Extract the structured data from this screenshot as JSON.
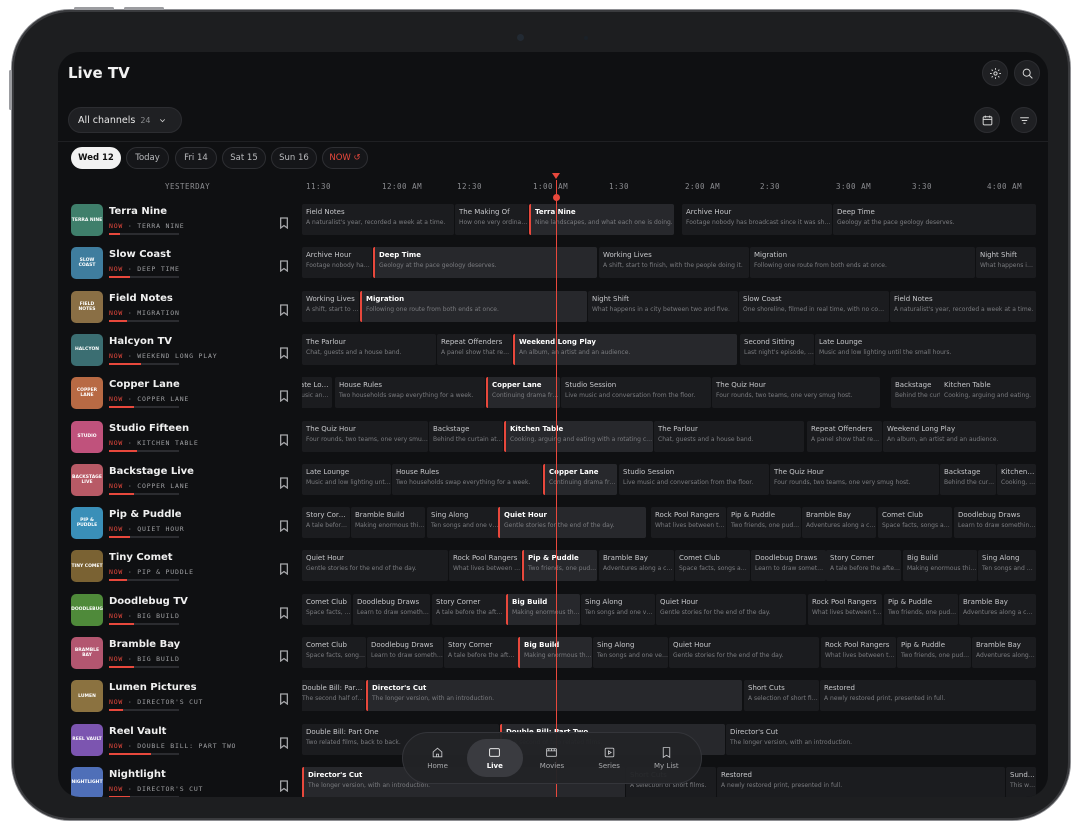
{
  "app": {
    "title": "Live TV"
  },
  "filter": {
    "label": "All channels",
    "count": "24"
  },
  "dates": [
    {
      "label": "Wed 12",
      "selected": true
    },
    {
      "label": "Today",
      "selected": false
    },
    {
      "label": "Fri 14",
      "selected": false
    },
    {
      "label": "Sat 15",
      "selected": false
    },
    {
      "label": "Sun 16",
      "selected": false
    },
    {
      "label": "NOW ↺",
      "selected": false,
      "now": true
    }
  ],
  "timeline": {
    "yesterday": "YESTERDAY",
    "slots": [
      "11:30",
      "12:00 AM",
      "12:30",
      "1:00 AM",
      "1:30",
      "2:00 AM",
      "2:30",
      "3:00 AM",
      "3:30",
      "4:00 AM"
    ]
  },
  "now_prefix": "NOW",
  "channels": [
    {
      "name": "Terra Nine",
      "logo": "TERRA NINE",
      "color": "#3f7f6b",
      "now": "TERRA NINE",
      "progress": 0.15,
      "programs": [
        {
          "title": "Field Notes",
          "desc": "A naturalist's year, recorded a week at a time."
        },
        {
          "title": "The Making Of",
          "desc": "How one very ordinary film was made."
        },
        {
          "title": "Terra Nine",
          "desc": "Nine landscapes, and what each one is doing.",
          "current": true
        },
        {
          "title": "Archive Hour",
          "desc": "Footage nobody has broadcast since it was shot."
        },
        {
          "title": "Deep Time",
          "desc": "Geology at the pace geology deserves."
        }
      ]
    },
    {
      "name": "Slow Coast",
      "logo": "SLOW COAST",
      "color": "#3f7d9e",
      "now": "DEEP TIME",
      "progress": 0.3,
      "programs": [
        {
          "title": "Archive Hour",
          "desc": "Footage nobody has broadcast."
        },
        {
          "title": "Deep Time",
          "desc": "Geology at the pace geology deserves.",
          "current": true
        },
        {
          "title": "Working Lives",
          "desc": "A shift, start to finish, with the people doing it."
        },
        {
          "title": "Migration",
          "desc": "Following one route from both ends at once."
        },
        {
          "title": "Night Shift",
          "desc": "What happens in a city between two and five."
        }
      ]
    },
    {
      "name": "Field Notes",
      "logo": "FIELD NOTES",
      "color": "#8a6f45",
      "now": "MIGRATION",
      "progress": 0.25,
      "programs": [
        {
          "title": "Working Lives",
          "desc": "A shift, start to finish."
        },
        {
          "title": "Migration",
          "desc": "Following one route from both ends at once.",
          "current": true
        },
        {
          "title": "Night Shift",
          "desc": "What happens in a city between two and five."
        },
        {
          "title": "Slow Coast",
          "desc": "One shoreline, filmed in real time, with no commentary."
        },
        {
          "title": "Field Notes",
          "desc": "A naturalist's year, recorded a week at a time."
        }
      ]
    },
    {
      "name": "Halcyon TV",
      "logo": "HALCYON",
      "color": "#3b6e72",
      "now": "WEEKEND LONG PLAY",
      "progress": 0.45,
      "programs": [
        {
          "title": "The Parlour",
          "desc": "Chat, guests and a house band."
        },
        {
          "title": "Repeat Offenders",
          "desc": "A panel show that repeats."
        },
        {
          "title": "Weekend Long Play",
          "desc": "An album, an artist and an audience.",
          "current": true
        },
        {
          "title": "Second Sitting",
          "desc": "Last night's episode, again."
        },
        {
          "title": "Late Lounge",
          "desc": "Music and low lighting until the small hours."
        }
      ]
    },
    {
      "name": "Copper Lane",
      "logo": "COPPER LANE",
      "color": "#b86a44",
      "now": "COPPER LANE",
      "progress": 0.35,
      "programs": [
        {
          "title": "Late Lounge",
          "desc": "Music and low lighting."
        },
        {
          "title": "House Rules",
          "desc": "Two households swap everything for a week."
        },
        {
          "title": "Copper Lane",
          "desc": "Continuing drama from the lane.",
          "current": true
        },
        {
          "title": "Studio Session",
          "desc": "Live music and conversation from the floor."
        },
        {
          "title": "The Quiz Hour",
          "desc": "Four rounds, two teams, one very smug host."
        },
        {
          "title": "Backstage",
          "desc": "Behind the curtain at a theatre."
        },
        {
          "title": "Kitchen Table",
          "desc": "Cooking, arguing and eating."
        }
      ]
    },
    {
      "name": "Studio Fifteen",
      "logo": "STUDIO",
      "color": "#c0527c",
      "now": "KITCHEN TABLE",
      "progress": 0.4,
      "programs": [
        {
          "title": "The Quiz Hour",
          "desc": "Four rounds, two teams, one very smug host."
        },
        {
          "title": "Backstage",
          "desc": "Behind the curtain at a theatre."
        },
        {
          "title": "Kitchen Table",
          "desc": "Cooking, arguing and eating with a rotating cast.",
          "current": true
        },
        {
          "title": "The Parlour",
          "desc": "Chat, guests and a house band."
        },
        {
          "title": "Repeat Offenders",
          "desc": "A panel show that repeats."
        },
        {
          "title": "Weekend Long Play",
          "desc": "An album, an artist and an audience."
        }
      ]
    },
    {
      "name": "Backstage Live",
      "logo": "BACKSTAGE LIVE",
      "color": "#b85a66",
      "now": "COPPER LANE",
      "progress": 0.35,
      "programs": [
        {
          "title": "Late Lounge",
          "desc": "Music and low lighting until the small hours."
        },
        {
          "title": "House Rules",
          "desc": "Two households swap everything for a week."
        },
        {
          "title": "Copper Lane",
          "desc": "Continuing drama from the lane.",
          "current": true
        },
        {
          "title": "Studio Session",
          "desc": "Live music and conversation from the floor."
        },
        {
          "title": "The Quiz Hour",
          "desc": "Four rounds, two teams, one very smug host."
        },
        {
          "title": "Backstage",
          "desc": "Behind the curtain at a theatre."
        },
        {
          "title": "Kitchen Table",
          "desc": "Cooking, arguing and eating."
        }
      ]
    },
    {
      "name": "Pip & Puddle",
      "logo": "PIP & PUDDLE",
      "color": "#3a8fb8",
      "now": "QUIET HOUR",
      "progress": 0.3,
      "programs": [
        {
          "title": "Story Corner",
          "desc": "A tale before bed."
        },
        {
          "title": "Bramble Build",
          "desc": "Making enormous things."
        },
        {
          "title": "Sing Along",
          "desc": "Ten songs and one very big finish."
        },
        {
          "title": "Quiet Hour",
          "desc": "Gentle stories for the end of the day.",
          "current": true
        },
        {
          "title": "Rock Pool Rangers",
          "desc": "What lives between the tides."
        },
        {
          "title": "Pip & Puddle",
          "desc": "Two friends, one puddle."
        },
        {
          "title": "Bramble Bay",
          "desc": "Adventures along a coast."
        },
        {
          "title": "Comet Club",
          "desc": "Space facts, songs and snacks."
        },
        {
          "title": "Doodlebug Draws",
          "desc": "Learn to draw something new."
        }
      ]
    },
    {
      "name": "Tiny Comet",
      "logo": "TINY COMET",
      "color": "#7a6233",
      "now": "PIP & PUDDLE",
      "progress": 0.25,
      "programs": [
        {
          "title": "Quiet Hour",
          "desc": "Gentle stories for the end of the day."
        },
        {
          "title": "Rock Pool Rangers",
          "desc": "What lives between the tides."
        },
        {
          "title": "Pip & Puddle",
          "desc": "Two friends, one puddle.",
          "current": true
        },
        {
          "title": "Bramble Bay",
          "desc": "Adventures along a coast."
        },
        {
          "title": "Comet Club",
          "desc": "Space facts, songs and snacks."
        },
        {
          "title": "Doodlebug Draws",
          "desc": "Learn to draw something new."
        },
        {
          "title": "Story Corner",
          "desc": "A tale before the afternoon."
        },
        {
          "title": "Big Build",
          "desc": "Making enormous things."
        },
        {
          "title": "Sing Along",
          "desc": "Ten songs and one finish."
        }
      ]
    },
    {
      "name": "Doodlebug TV",
      "logo": "DOODLEBUG",
      "color": "#4f8a3a",
      "now": "BIG BUILD",
      "progress": 0.35,
      "programs": [
        {
          "title": "Comet Club",
          "desc": "Space facts, songs and snacks."
        },
        {
          "title": "Doodlebug Draws",
          "desc": "Learn to draw something new."
        },
        {
          "title": "Story Corner",
          "desc": "A tale before the afternoon."
        },
        {
          "title": "Big Build",
          "desc": "Making enormous things.",
          "current": true
        },
        {
          "title": "Sing Along",
          "desc": "Ten songs and one very big finish."
        },
        {
          "title": "Quiet Hour",
          "desc": "Gentle stories for the end of the day."
        },
        {
          "title": "Rock Pool Rangers",
          "desc": "What lives between the tides."
        },
        {
          "title": "Pip & Puddle",
          "desc": "Two friends, one puddle."
        },
        {
          "title": "Bramble Bay",
          "desc": "Adventures along a coast."
        }
      ]
    },
    {
      "name": "Bramble Bay",
      "logo": "BRAMBLE BAY",
      "color": "#b35670",
      "now": "BIG BUILD",
      "progress": 0.35,
      "programs": [
        {
          "title": "Comet Club",
          "desc": "Space facts, songs and snacks."
        },
        {
          "title": "Doodlebug Draws",
          "desc": "Learn to draw something new."
        },
        {
          "title": "Story Corner",
          "desc": "A tale before the afternoon."
        },
        {
          "title": "Big Build",
          "desc": "Making enormous things.",
          "current": true
        },
        {
          "title": "Sing Along",
          "desc": "Ten songs and one very big finish."
        },
        {
          "title": "Quiet Hour",
          "desc": "Gentle stories for the end of the day."
        },
        {
          "title": "Rock Pool Rangers",
          "desc": "What lives between the tides."
        },
        {
          "title": "Pip & Puddle",
          "desc": "Two friends, one puddle."
        },
        {
          "title": "Bramble Bay",
          "desc": "Adventures along a coast."
        }
      ]
    },
    {
      "name": "Lumen Pictures",
      "logo": "LUMEN",
      "color": "#8b7240",
      "now": "DIRECTOR'S CUT",
      "progress": 0.2,
      "programs": [
        {
          "title": "Double Bill: Part Two",
          "desc": "The second half of the double bill."
        },
        {
          "title": "Director's Cut",
          "desc": "The longer version, with an introduction.",
          "current": true
        },
        {
          "title": "Short Cuts",
          "desc": "A selection of short films."
        },
        {
          "title": "Restored",
          "desc": "A newly restored print, presented in full."
        }
      ]
    },
    {
      "name": "Reel Vault",
      "logo": "REEL VAULT",
      "color": "#7c55b0",
      "now": "DOUBLE BILL: PART TWO",
      "progress": 0.6,
      "programs": [
        {
          "title": "Double Bill: Part One",
          "desc": "Two related films, back to back."
        },
        {
          "title": "Double Bill: Part Two",
          "desc": "The second of two related films.",
          "current": true
        },
        {
          "title": "Director's Cut",
          "desc": "The longer version, with an introduction."
        }
      ]
    },
    {
      "name": "Nightlight",
      "logo": "NIGHTLIGHT",
      "color": "#4f6fb8",
      "now": "DIRECTOR'S CUT",
      "progress": 0.3,
      "programs": [
        {
          "title": "Director's Cut",
          "desc": "The longer version, with an introduction.",
          "current": true
        },
        {
          "title": "Short Cuts",
          "desc": "A selection of short films."
        },
        {
          "title": "Restored",
          "desc": "A newly restored print, presented in full."
        },
        {
          "title": "Sunday",
          "desc": "This week."
        }
      ]
    }
  ],
  "tabs": [
    {
      "label": "Home",
      "icon": "home-icon"
    },
    {
      "label": "Live",
      "icon": "play-icon",
      "active": true
    },
    {
      "label": "Movies",
      "icon": "film-icon"
    },
    {
      "label": "Series",
      "icon": "series-icon"
    },
    {
      "label": "My List",
      "icon": "bookmark-icon"
    }
  ],
  "colors": {
    "accent": "#e8483c",
    "background": "#0f1012",
    "card": "#1b1c1f",
    "card_current": "#27282c"
  }
}
